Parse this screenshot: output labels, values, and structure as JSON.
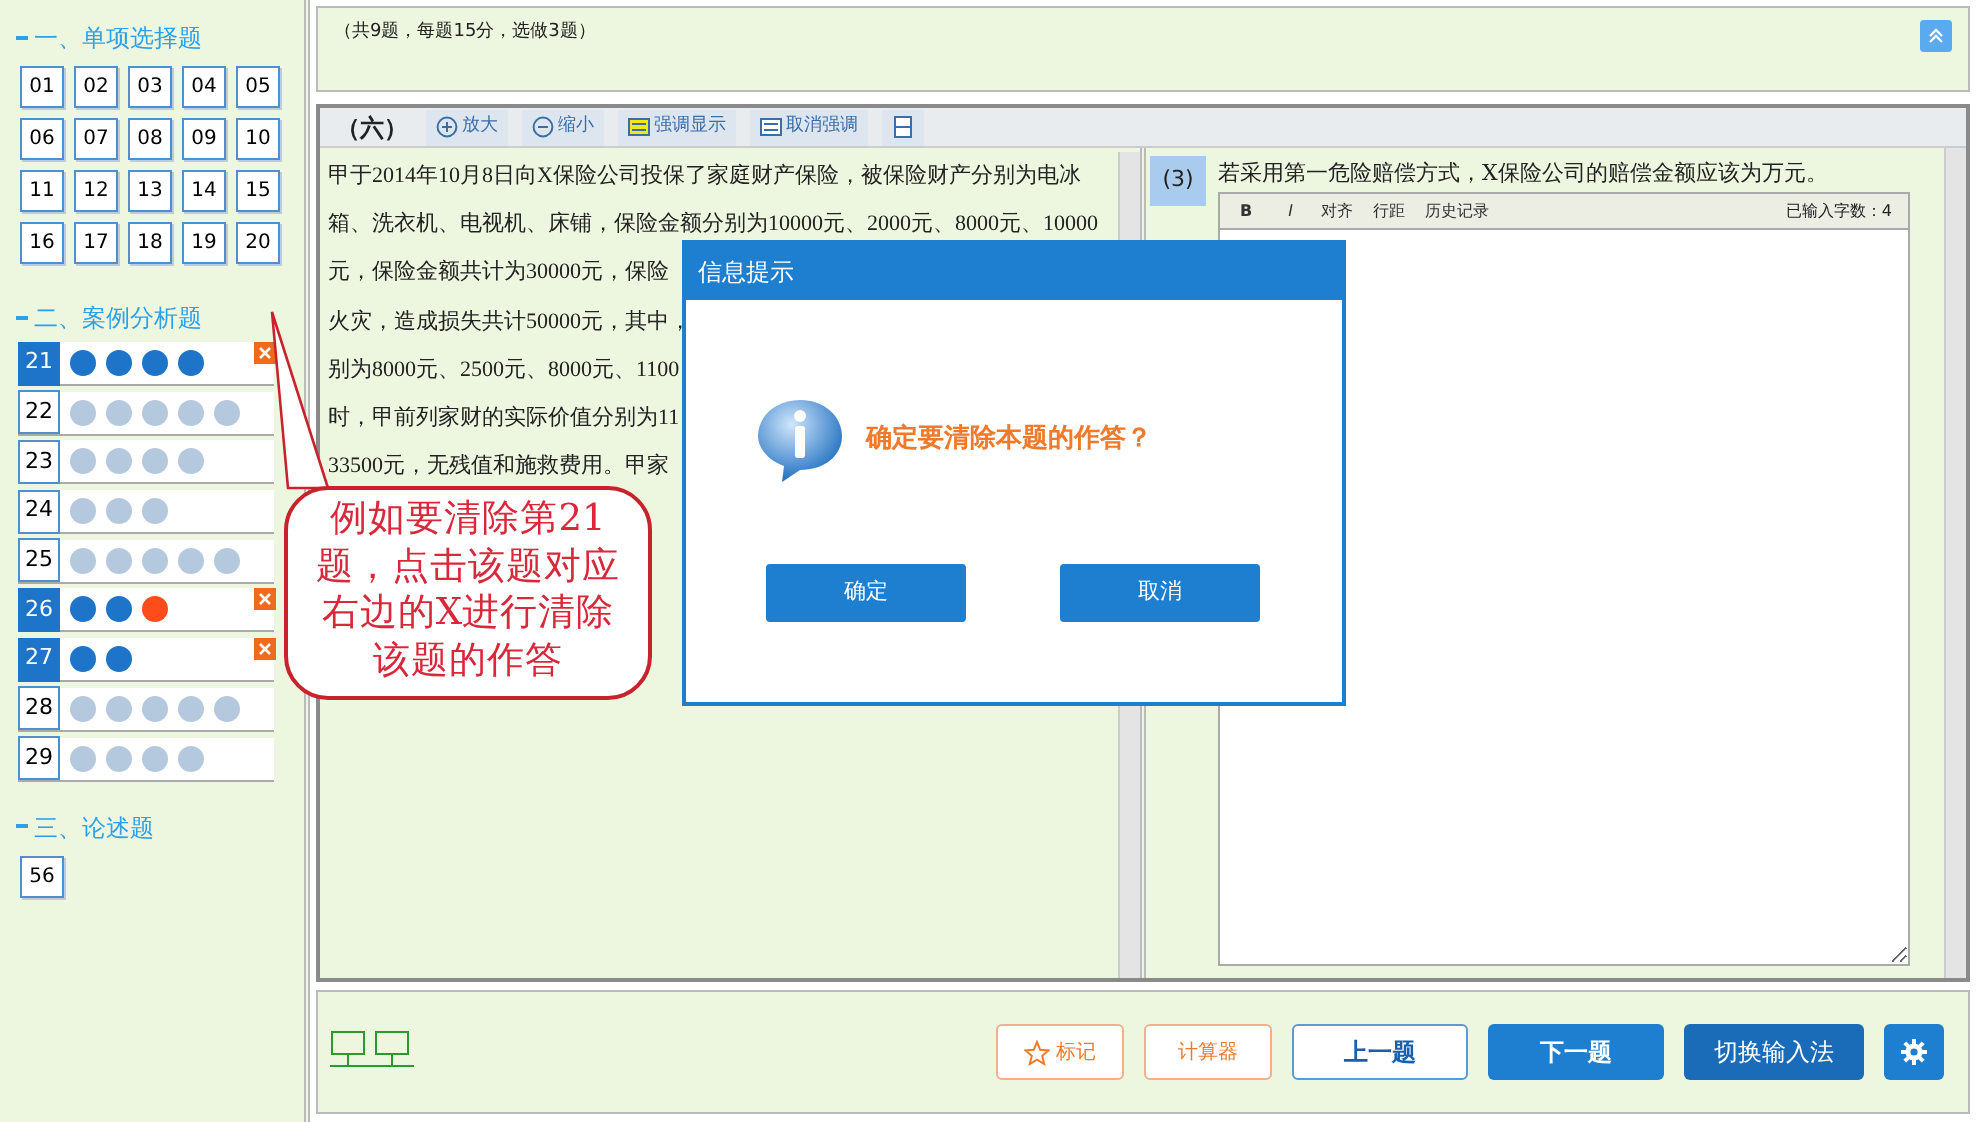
{
  "sidebar": {
    "sections": [
      {
        "title": "一、单项选择题",
        "kind": "grid",
        "items": [
          {
            "number": "01"
          },
          {
            "number": "02"
          },
          {
            "number": "03"
          },
          {
            "number": "04"
          },
          {
            "number": "05"
          },
          {
            "number": "06"
          },
          {
            "number": "07"
          },
          {
            "number": "08"
          },
          {
            "number": "09"
          },
          {
            "number": "10"
          },
          {
            "number": "11"
          },
          {
            "number": "12"
          },
          {
            "number": "13"
          },
          {
            "number": "14"
          },
          {
            "number": "15"
          },
          {
            "number": "16"
          },
          {
            "number": "17"
          },
          {
            "number": "18"
          },
          {
            "number": "19"
          },
          {
            "number": "20"
          }
        ]
      },
      {
        "title": "二、案例分析题",
        "kind": "case",
        "items": [
          {
            "number": "21",
            "answered": true,
            "dots": [
              {
                "filled": true,
                "current": false
              },
              {
                "filled": true,
                "current": false
              },
              {
                "filled": true,
                "current": false
              },
              {
                "filled": true,
                "current": false
              }
            ]
          },
          {
            "number": "22",
            "answered": false,
            "dots": [
              {
                "filled": false,
                "current": false
              },
              {
                "filled": false,
                "current": false
              },
              {
                "filled": false,
                "current": false
              },
              {
                "filled": false,
                "current": false
              },
              {
                "filled": false,
                "current": false
              }
            ]
          },
          {
            "number": "23",
            "answered": false,
            "dots": [
              {
                "filled": false,
                "current": false
              },
              {
                "filled": false,
                "current": false
              },
              {
                "filled": false,
                "current": false
              },
              {
                "filled": false,
                "current": false
              }
            ]
          },
          {
            "number": "24",
            "answered": false,
            "dots": [
              {
                "filled": false,
                "current": false
              },
              {
                "filled": false,
                "current": false
              },
              {
                "filled": false,
                "current": false
              }
            ]
          },
          {
            "number": "25",
            "answered": false,
            "dots": [
              {
                "filled": false,
                "current": false
              },
              {
                "filled": false,
                "current": false
              },
              {
                "filled": false,
                "current": false
              },
              {
                "filled": false,
                "current": false
              },
              {
                "filled": false,
                "current": false
              }
            ]
          },
          {
            "number": "26",
            "answered": true,
            "dots": [
              {
                "filled": true,
                "current": false
              },
              {
                "filled": true,
                "current": false
              },
              {
                "filled": true,
                "current": true
              }
            ]
          },
          {
            "number": "27",
            "answered": true,
            "dots": [
              {
                "filled": true,
                "current": false
              },
              {
                "filled": true,
                "current": false
              }
            ]
          },
          {
            "number": "28",
            "answered": false,
            "dots": [
              {
                "filled": false,
                "current": false
              },
              {
                "filled": false,
                "current": false
              },
              {
                "filled": false,
                "current": false
              },
              {
                "filled": false,
                "current": false
              },
              {
                "filled": false,
                "current": false
              }
            ]
          },
          {
            "number": "29",
            "answered": false,
            "dots": [
              {
                "filled": false,
                "current": false
              },
              {
                "filled": false,
                "current": false
              },
              {
                "filled": false,
                "current": false
              },
              {
                "filled": false,
                "current": false
              }
            ]
          }
        ]
      },
      {
        "title": "三、论述题",
        "kind": "grid",
        "items": [
          {
            "number": "56"
          }
        ]
      }
    ]
  },
  "header": {
    "summary": "（共9题，每题15分，选做3题）"
  },
  "question": {
    "label": "（六）",
    "tools": [
      {
        "kind": "plus",
        "label": "放大"
      },
      {
        "kind": "minus",
        "label": "缩小"
      },
      {
        "kind": "highlight",
        "label": "强调显示"
      },
      {
        "kind": "unhighlight",
        "label": "取消强调"
      },
      {
        "kind": "split"
      }
    ],
    "passage_lines": [
      "甲于2014年10月8日向X保险公司投保了家庭财产保险，被保险财产分别为电冰",
      "箱、洗衣机、电视机、床铺，保险金额分别为10000元、2000元、8000元、10000",
      "元，保险金额共计为30000元，保险",
      "火灾，造成损失共计50000元，其中，",
      "别为8000元、2500元、8000元、1100",
      "时，甲前列家财的实际价值分别为11",
      "33500元，无残值和施救费用。甲家"
    ],
    "sub_label": "(3)",
    "sub_text": "若采用第一危险赔偿方式，X保险公司的赔偿金额应该为万元。",
    "editor": {
      "tools": [
        {
          "kind": "bold",
          "label": "B"
        },
        {
          "kind": "italic",
          "label": "I"
        },
        {
          "kind": "text",
          "label": "对齐"
        },
        {
          "kind": "text",
          "label": "行距"
        },
        {
          "kind": "text",
          "label": "历史记录"
        }
      ],
      "counter": "已输入字数：4"
    }
  },
  "footer": {
    "buttons": [
      {
        "kind": "mark",
        "label": "标记"
      },
      {
        "kind": "tool",
        "label": "计算器"
      },
      {
        "kind": "outline",
        "label": "上一题"
      },
      {
        "kind": "primary",
        "label": "下一题"
      },
      {
        "kind": "dark",
        "label": "切换输入法"
      },
      {
        "kind": "settings"
      }
    ]
  },
  "dialog": {
    "title": "信息提示",
    "message": "确定要清除本题的作答？",
    "buttons": [
      "确定",
      "取消"
    ]
  },
  "callout": {
    "lines": [
      "例如要清除第21",
      "题，点击该题对应",
      "右边的X进行清除",
      "该题的作答"
    ]
  }
}
